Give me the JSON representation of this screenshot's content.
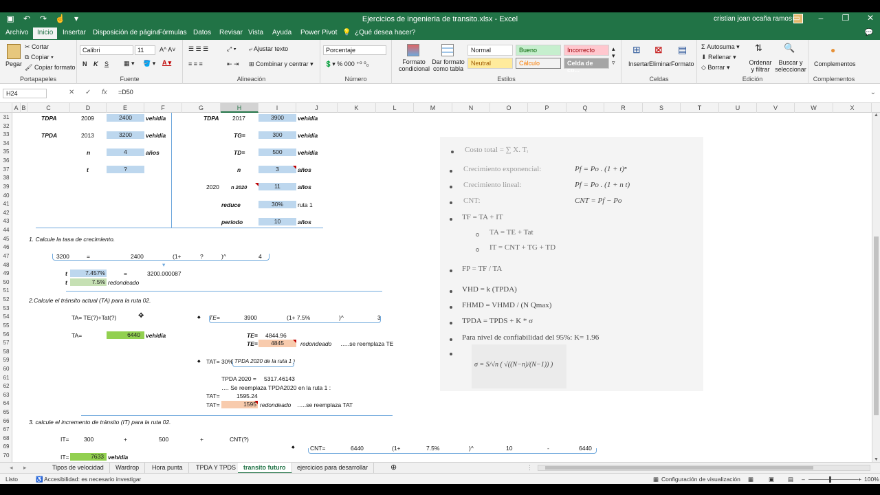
{
  "window": {
    "title": "Ejercicios de ingenieria de transito.xlsx  -  Excel",
    "user": "cristian joan ocaña ramos"
  },
  "menu_tabs": [
    "Archivo",
    "Inicio",
    "Insertar",
    "Disposición de página",
    "Fórmulas",
    "Datos",
    "Revisar",
    "Vista",
    "Ayuda",
    "Power Pivot",
    "¿Qué desea hacer?"
  ],
  "ribbon": {
    "portapapeles": {
      "label": "Portapapeles",
      "pegar": "Pegar",
      "cortar": "Cortar",
      "copiar": "Copiar",
      "copiar_formato": "Copiar formato"
    },
    "fuente": {
      "label": "Fuente",
      "font": "Calibri",
      "size": "11",
      "bold": "N",
      "italic": "K",
      "underline": "S"
    },
    "alineacion": {
      "label": "Alineación",
      "ajustar": "Ajustar texto",
      "combinar": "Combinar y centrar"
    },
    "numero": {
      "label": "Número",
      "format": "Porcentaje"
    },
    "estilos": {
      "label": "Estilos",
      "formato_condicional": "Formato condicional",
      "dar_formato": "Dar formato como tabla",
      "styles": [
        "Normal",
        "Bueno",
        "Incorrecto",
        "Neutral",
        "Cálculo",
        "Celda de co..."
      ]
    },
    "celdas": {
      "label": "Celdas",
      "insertar": "Insertar",
      "eliminar": "Eliminar",
      "formato": "Formato"
    },
    "edicion": {
      "label": "Edición",
      "autosuma": "Autosuma",
      "rellenar": "Rellenar",
      "borrar": "Borrar",
      "ordenar": "Ordenar y filtrar",
      "buscar": "Buscar y seleccionar"
    },
    "complementos": {
      "label": "Complementos",
      "btn": "Complementos"
    }
  },
  "formula_bar": {
    "cell": "H24",
    "formula": "=D50"
  },
  "columns": [
    "A",
    "B",
    "C",
    "D",
    "E",
    "F",
    "G",
    "H",
    "I",
    "J",
    "K",
    "L",
    "M",
    "N",
    "O",
    "P",
    "Q",
    "R",
    "S",
    "T",
    "U",
    "V",
    "W",
    "X"
  ],
  "rows": [
    "31",
    "32",
    "33",
    "34",
    "35",
    "36",
    "37",
    "38",
    "39",
    "40",
    "41",
    "42",
    "43",
    "44",
    "45",
    "46",
    "47",
    "48",
    "49",
    "50",
    "51",
    "52",
    "53",
    "54",
    "55",
    "56",
    "57",
    "58",
    "59",
    "60",
    "61",
    "62",
    "63",
    "64",
    "65",
    "66",
    "67",
    "68",
    "69",
    "70"
  ],
  "sheet": {
    "r31": {
      "c": "TDPA",
      "d": "2009",
      "e": "2400",
      "f": "veh/día",
      "g": "TDPA",
      "h": "2017",
      "i": "3900",
      "j": "veh/día"
    },
    "r33": {
      "c": "TPDA",
      "d": "2013",
      "e": "3200",
      "f": "veh/día",
      "h": "TG=",
      "i": "300",
      "j": "veh/día"
    },
    "r35": {
      "d": "n",
      "e": "4",
      "f": "años",
      "h": "TD=",
      "i": "500",
      "j": "veh/día"
    },
    "r37": {
      "d": "t",
      "e": "?",
      "h": "n",
      "i": "3",
      "j": "años"
    },
    "r39": {
      "g": "2020",
      "h": "n 2020",
      "i": "11",
      "j": "años"
    },
    "r41": {
      "h": "reduce",
      "i": "30%",
      "j": "ruta 1"
    },
    "r43": {
      "h": "periodo",
      "i": "10",
      "j": "años"
    },
    "q1": "1. Calcule la tasa de crecimiento.",
    "r47": {
      "a": "3200",
      "b": "=",
      "c": "2400",
      "d": "(1+",
      "e": "?",
      "f": ")^",
      "g": "4"
    },
    "r49": {
      "t": "t",
      "v": "7.457%",
      "eq": "=",
      "res": "3200.000087"
    },
    "r50": {
      "t": "t",
      "v": "7.5%",
      "note": "redondeado"
    },
    "q2": "2.Calcule el tránsito actual (TA) para la ruta 02.",
    "r54": {
      "ta": "TA= TE(?)+Tat(?)",
      "te": "TE=",
      "v1": "3900",
      "v2": "(1+ 7.5%",
      "v3": ")^",
      "v4": "3"
    },
    "r56": {
      "ta": "TA=",
      "v": "6440",
      "u": "veh/día",
      "te": "TE=",
      "tev": "4844.96"
    },
    "r57": {
      "te": "TE=",
      "v": "4845",
      "note": "redondeado",
      "note2": "…..se reemplaza TE"
    },
    "r59": {
      "tat": "TAT=",
      "v": "30%",
      "expr": "( TPDA 2020 de la ruta 1 )"
    },
    "r61": {
      "lbl": "TPDA 2020 =",
      "v": "5317.46143"
    },
    "r62": {
      "txt": "…. Se reemplaza TPDA2020 en la ruta 1 :"
    },
    "r63": {
      "lbl": "TAT=",
      "v": "1595.24"
    },
    "r64": {
      "lbl": "TAT=",
      "v": "1595",
      "note": "redondeado",
      "note2": "…..se reemplaza TAT"
    },
    "q3": "3. calcule el incremento de tránsito (IT) para la ruta 02.",
    "r68": {
      "it": "IT=",
      "v1": "300",
      "p1": "+",
      "v2": "500",
      "p2": "+",
      "cnt": "CNT(?)"
    },
    "r70": {
      "it": "IT=",
      "v": "7633",
      "u": "veh/día",
      "cnt": "CNT=",
      "c1": "6440",
      "c2": "(1+",
      "c3": "7.5%",
      "c4": ")^",
      "c5": "10",
      "c6": "-",
      "c7": "6440"
    }
  },
  "formulas": [
    "Costo total = ∑ X. Tᵢ",
    "Crecimiento exponencial:",
    "Pf = Po . (1 + t)ⁿ",
    "Crecimiento lineal:",
    "Pf = Po . (1 + n t)",
    "CNT:",
    "CNT = Pf − Po",
    "TF = TA + IT",
    "TA = TE + Tat",
    "IT = CNT + TG + TD",
    "FP = TF / TA",
    "VHD = k (TPDA)",
    "FHMD = VHMD / (N Qmax)",
    "TPDA = TPDS + K * σ",
    "Para nivel de confiabilidad del 95%: K= 1.96",
    "σ = S/√n ( √((N−n)/(N−1)) )"
  ],
  "sheet_tabs": [
    "Tipos de velocidad",
    "Wardrop",
    "Hora punta",
    "TPDA Y TPDS",
    "transito futuro",
    "ejercicios para desarrollar"
  ],
  "active_sheet": "transito futuro",
  "status": {
    "ready": "Listo",
    "accessibility": "Accesibilidad: es necesario investigar",
    "view_config": "Configuración de visualización",
    "zoom": "100%"
  }
}
